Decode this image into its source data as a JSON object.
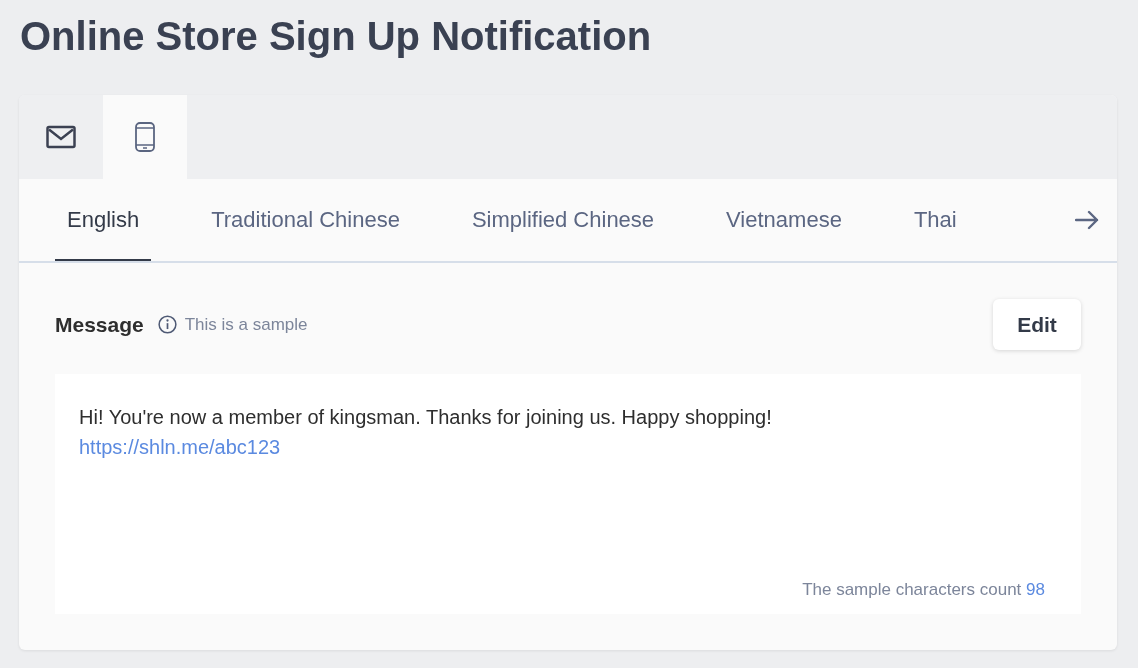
{
  "title": "Online Store Sign Up Notification",
  "channel_tabs": [
    {
      "kind": "email",
      "selected": false
    },
    {
      "kind": "phone",
      "selected": true
    }
  ],
  "language_tabs": [
    {
      "label": "English",
      "selected": true
    },
    {
      "label": "Traditional Chinese",
      "selected": false
    },
    {
      "label": "Simplified Chinese",
      "selected": false
    },
    {
      "label": "Vietnamese",
      "selected": false
    },
    {
      "label": "Thai",
      "selected": false
    }
  ],
  "message": {
    "label": "Message",
    "hint": "This is a sample",
    "edit_button": "Edit",
    "text": "Hi! You're now a member of kingsman. Thanks for joining us. Happy shopping!",
    "link": "https://shln.me/abc123",
    "count_label": "The sample characters count",
    "count": "98"
  }
}
